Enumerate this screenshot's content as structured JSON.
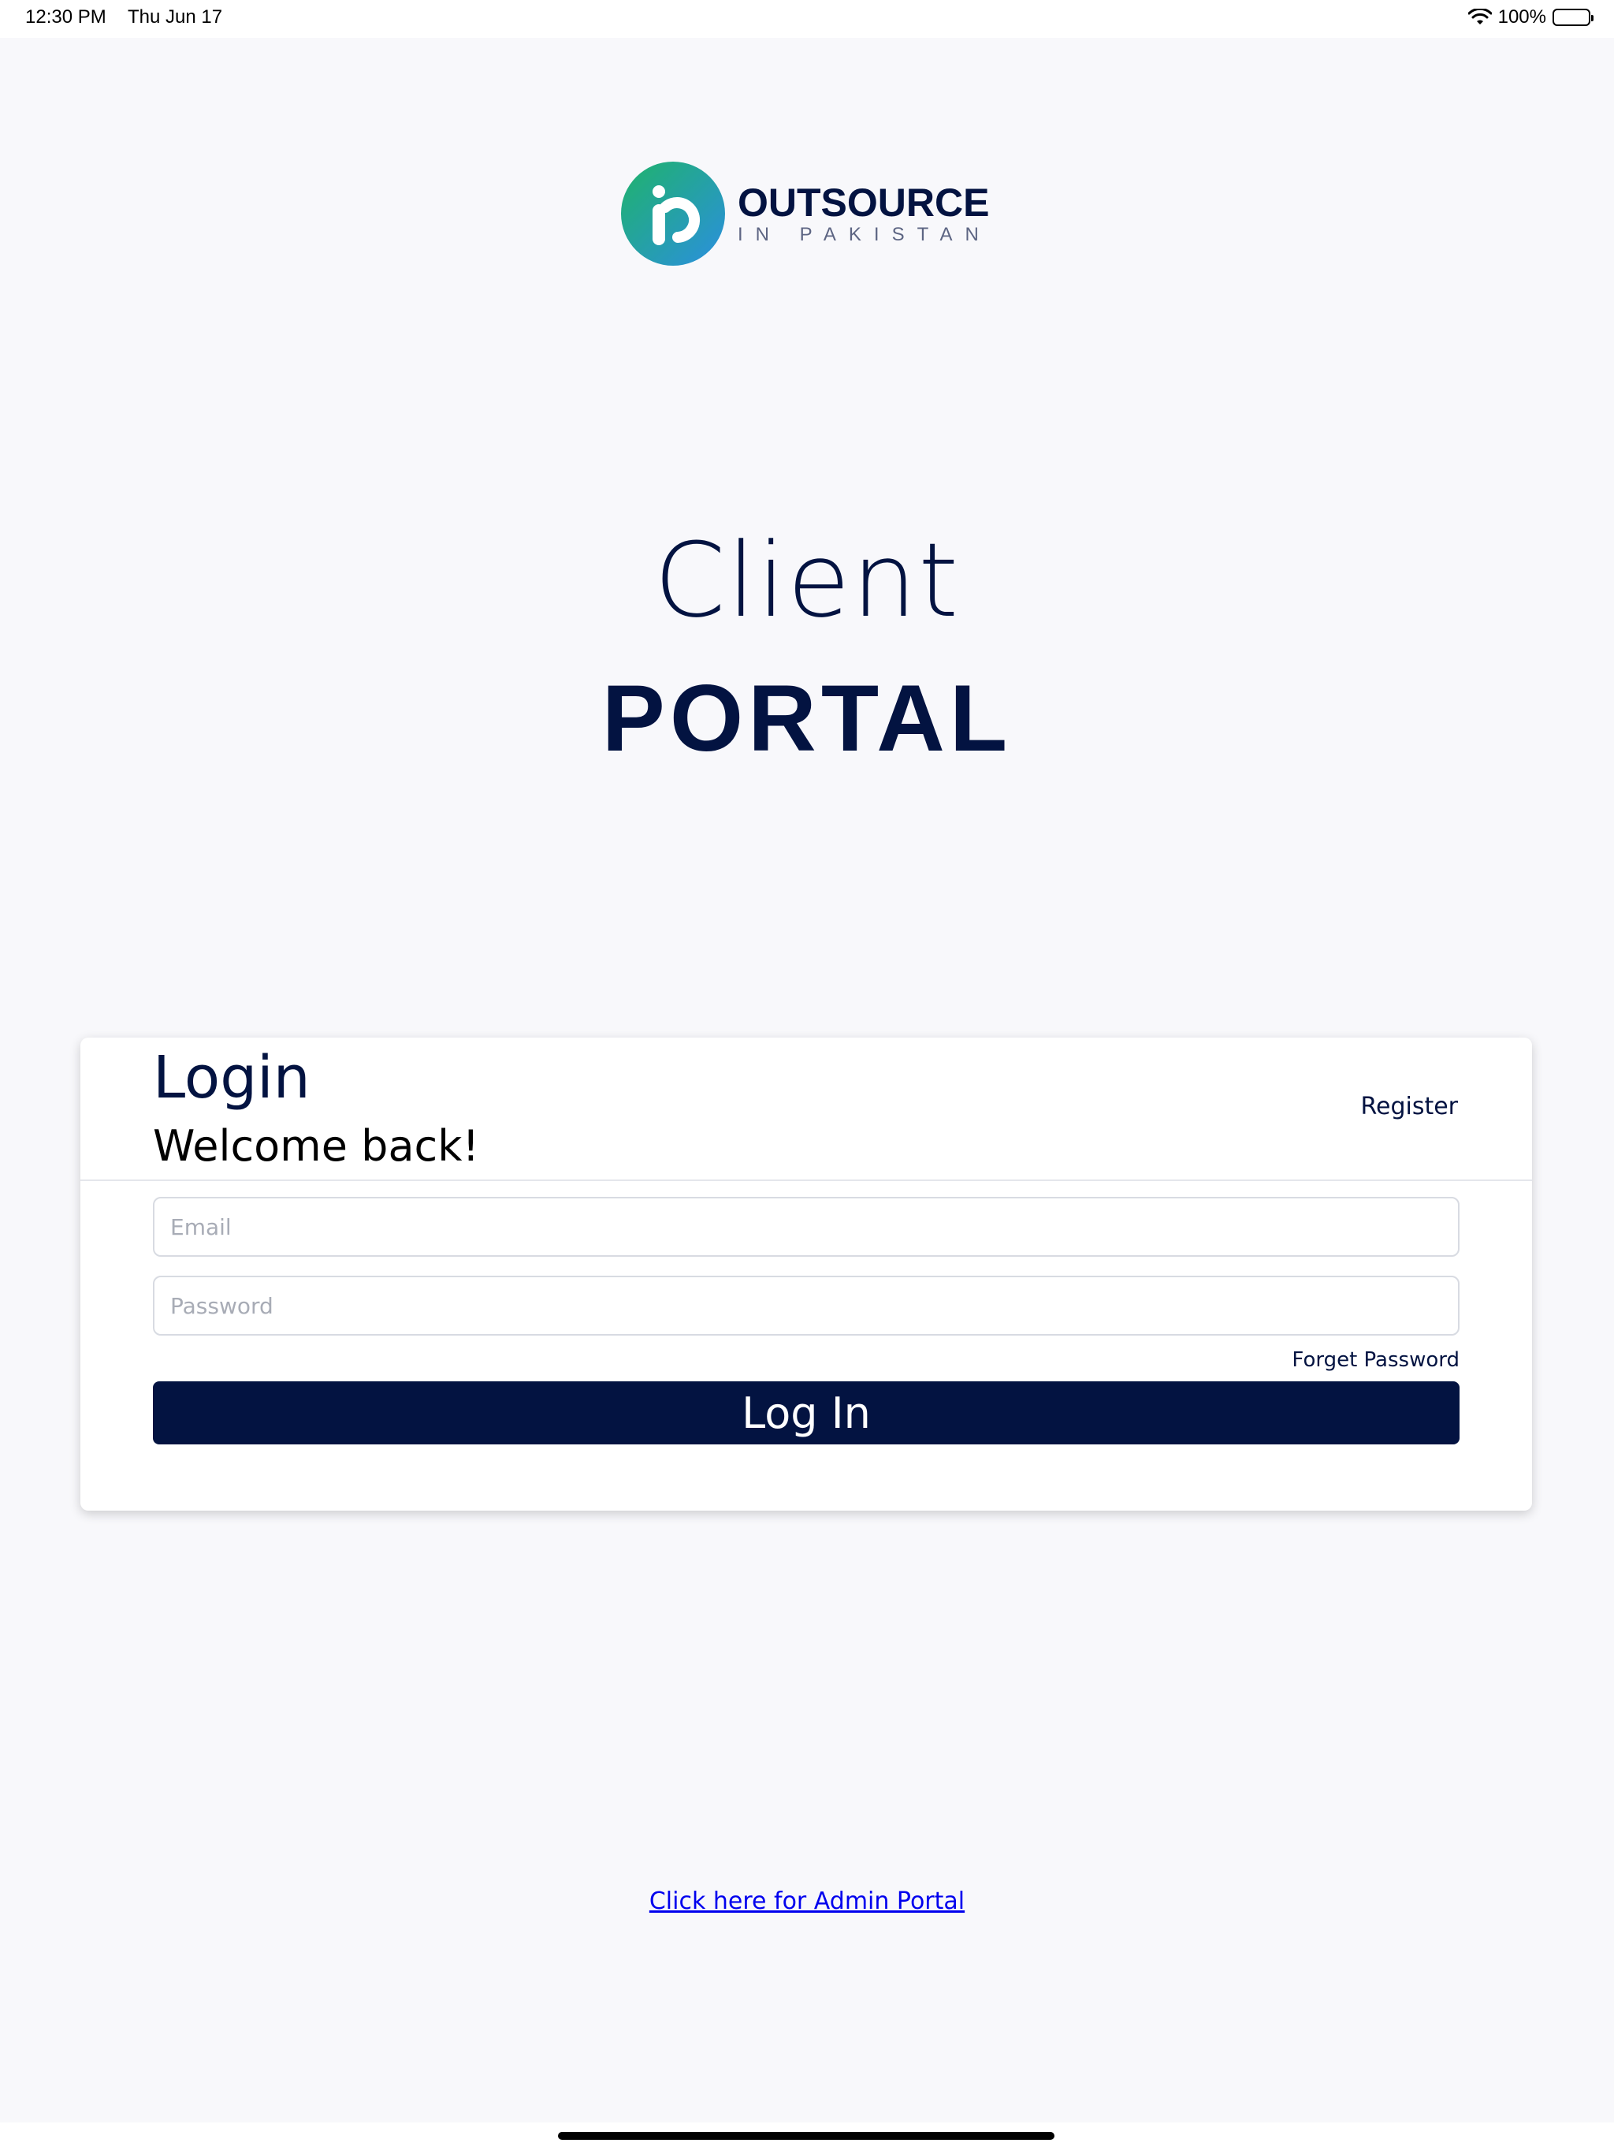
{
  "status_bar": {
    "time": "12:30 PM",
    "date": "Thu Jun 17",
    "battery": "100%",
    "battery_level": 1.0,
    "icons": [
      "wifi-icon",
      "battery-icon"
    ]
  },
  "logo": {
    "name_top": "OUTSOURCE",
    "name_bottom": "IN PAKISTAN",
    "gradient_colors": [
      "#1fb36a",
      "#2b8fe0"
    ]
  },
  "hero": {
    "line1": "Client",
    "line2": "PORTAL"
  },
  "login": {
    "title": "Login",
    "subtitle": "Welcome back!",
    "register_label": "Register",
    "email_placeholder": "Email",
    "email_value": "",
    "password_placeholder": "Password",
    "password_value": "",
    "forget_password_label": "Forget Password",
    "submit_label": "Log In"
  },
  "footer": {
    "admin_link_label": "Click here for Admin Portal"
  },
  "colors": {
    "brand_navy": "#031341",
    "background": "#f8f8fb",
    "link_blue": "#0000ee"
  }
}
